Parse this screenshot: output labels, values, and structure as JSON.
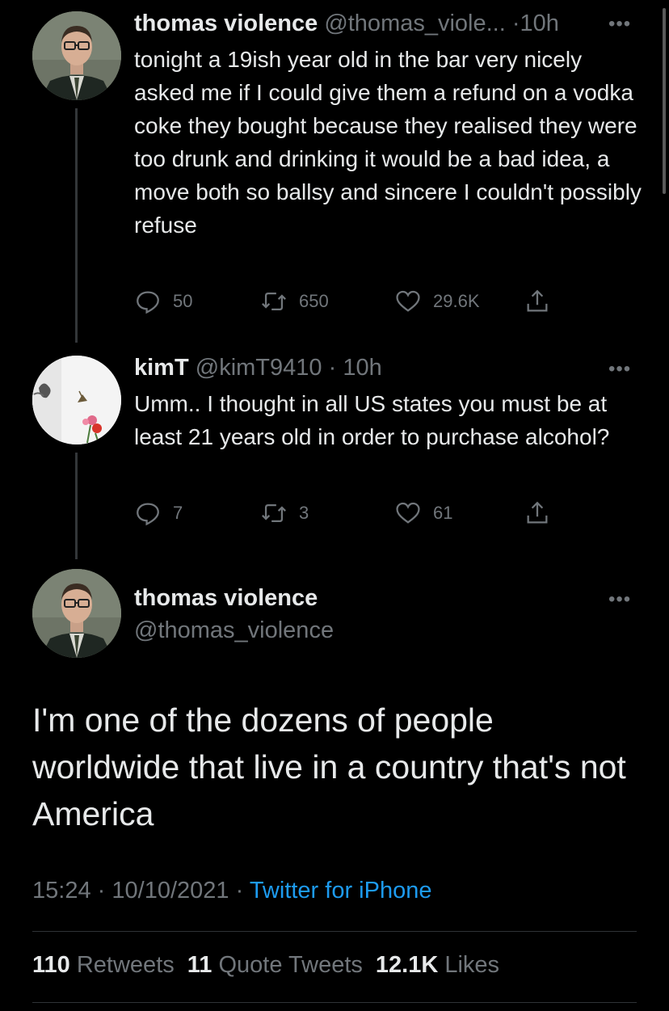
{
  "tweet1": {
    "name": "thomas violence",
    "handle": "@thomas_viole...",
    "time": "10h",
    "text": "tonight a 19ish year old in the bar very nicely asked me if I could give them a refund on a vodka coke they bought because they realised they were too drunk and drinking it would be a bad idea, a move both so ballsy and sincere I couldn't possibly refuse",
    "replies": "50",
    "retweets": "650",
    "likes": "29.6K"
  },
  "tweet2": {
    "name": "kimT",
    "handle": "@kimT9410",
    "time": "10h",
    "text": "Umm.. I thought in all US states you must be at least 21 years old in order to purchase alcohol?",
    "replies": "7",
    "retweets": "3",
    "likes": "61"
  },
  "main_tweet": {
    "name": "thomas violence",
    "handle": "@thomas_violence",
    "text": "I'm one of the dozens of people worldwide that live in a country that's not America",
    "time": "15:24",
    "date": "10/10/2021",
    "source": "Twitter for iPhone",
    "retweets_count": "110",
    "retweets_label": "Retweets",
    "quote_count": "11",
    "quote_label": "Quote Tweets",
    "likes_count": "12.1K",
    "likes_label": "Likes"
  },
  "icons": {
    "more": "more-icon",
    "reply": "reply-icon",
    "retweet": "retweet-icon",
    "like": "heart-icon",
    "share": "share-icon"
  },
  "colors": {
    "background": "#000000",
    "text": "#e7e9ea",
    "muted": "#71767b",
    "link": "#1d9bf0"
  }
}
